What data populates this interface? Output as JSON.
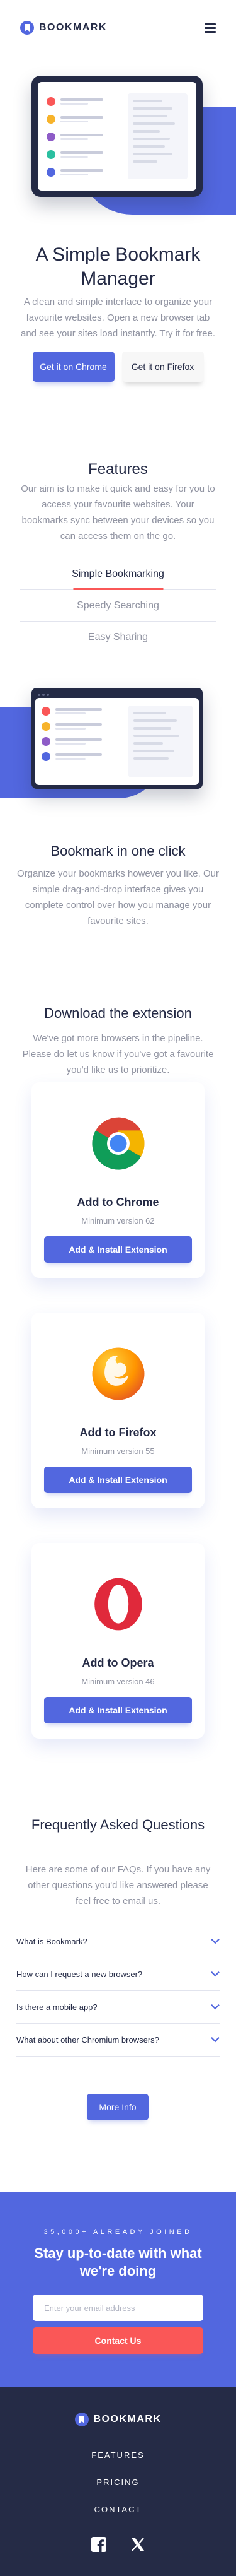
{
  "brand": {
    "name": "BOOKMARK",
    "primary_color": "#5267DF",
    "accent_color": "#FA5757",
    "dark_color": "#252B46"
  },
  "header": {
    "menu_icon": "hamburger-menu-icon"
  },
  "hero": {
    "title": "A Simple Bookmark Manager",
    "text": "A clean and simple interface to organize your favourite websites. Open a new browser tab and see your sites load instantly. Try it for free.",
    "primary_button": "Get it on Chrome",
    "secondary_button": "Get it on Firefox"
  },
  "features": {
    "title": "Features",
    "text": "Our aim is to make it quick and easy for you to access your favourite websites. Your bookmarks sync between your devices so you can access them on the go.",
    "tabs": [
      {
        "label": "Simple Bookmarking",
        "active": true
      },
      {
        "label": "Speedy Searching",
        "active": false
      },
      {
        "label": "Easy Sharing",
        "active": false
      }
    ],
    "panel_title": "Bookmark in one click",
    "panel_text": "Organize your bookmarks however you like. Our simple drag-and-drop interface gives you complete control over how you manage your favourite sites."
  },
  "download": {
    "title": "Download the extension",
    "text": "We've got more browsers in the pipeline. Please do let us know if you've got a favourite you'd like us to prioritize.",
    "cards": [
      {
        "title": "Add to Chrome",
        "sub": "Minimum version 62",
        "button": "Add & Install Extension",
        "icon": "chrome-logo-icon"
      },
      {
        "title": "Add to Firefox",
        "sub": "Minimum version 55",
        "button": "Add & Install Extension",
        "icon": "firefox-logo-icon"
      },
      {
        "title": "Add to Opera",
        "sub": "Minimum version 46",
        "button": "Add & Install Extension",
        "icon": "opera-logo-icon"
      }
    ]
  },
  "faq": {
    "title": "Frequently Asked Questions",
    "text": "Here are some of our FAQs. If you have any other questions you'd like answered please feel free to email us.",
    "questions": [
      "What is Bookmark?",
      "How can I request a new browser?",
      "Is there a mobile app?",
      "What about other Chromium browsers?"
    ],
    "more_button": "More Info"
  },
  "newsletter": {
    "eyebrow": "35,000+ ALREADY JOINED",
    "title": "Stay up-to-date with what we're doing",
    "placeholder": "Enter your email address",
    "button": "Contact Us"
  },
  "footer": {
    "brand": "BOOKMARK",
    "links": [
      "FEATURES",
      "PRICING",
      "CONTACT"
    ],
    "social": [
      "facebook-icon",
      "x-twitter-icon"
    ]
  }
}
